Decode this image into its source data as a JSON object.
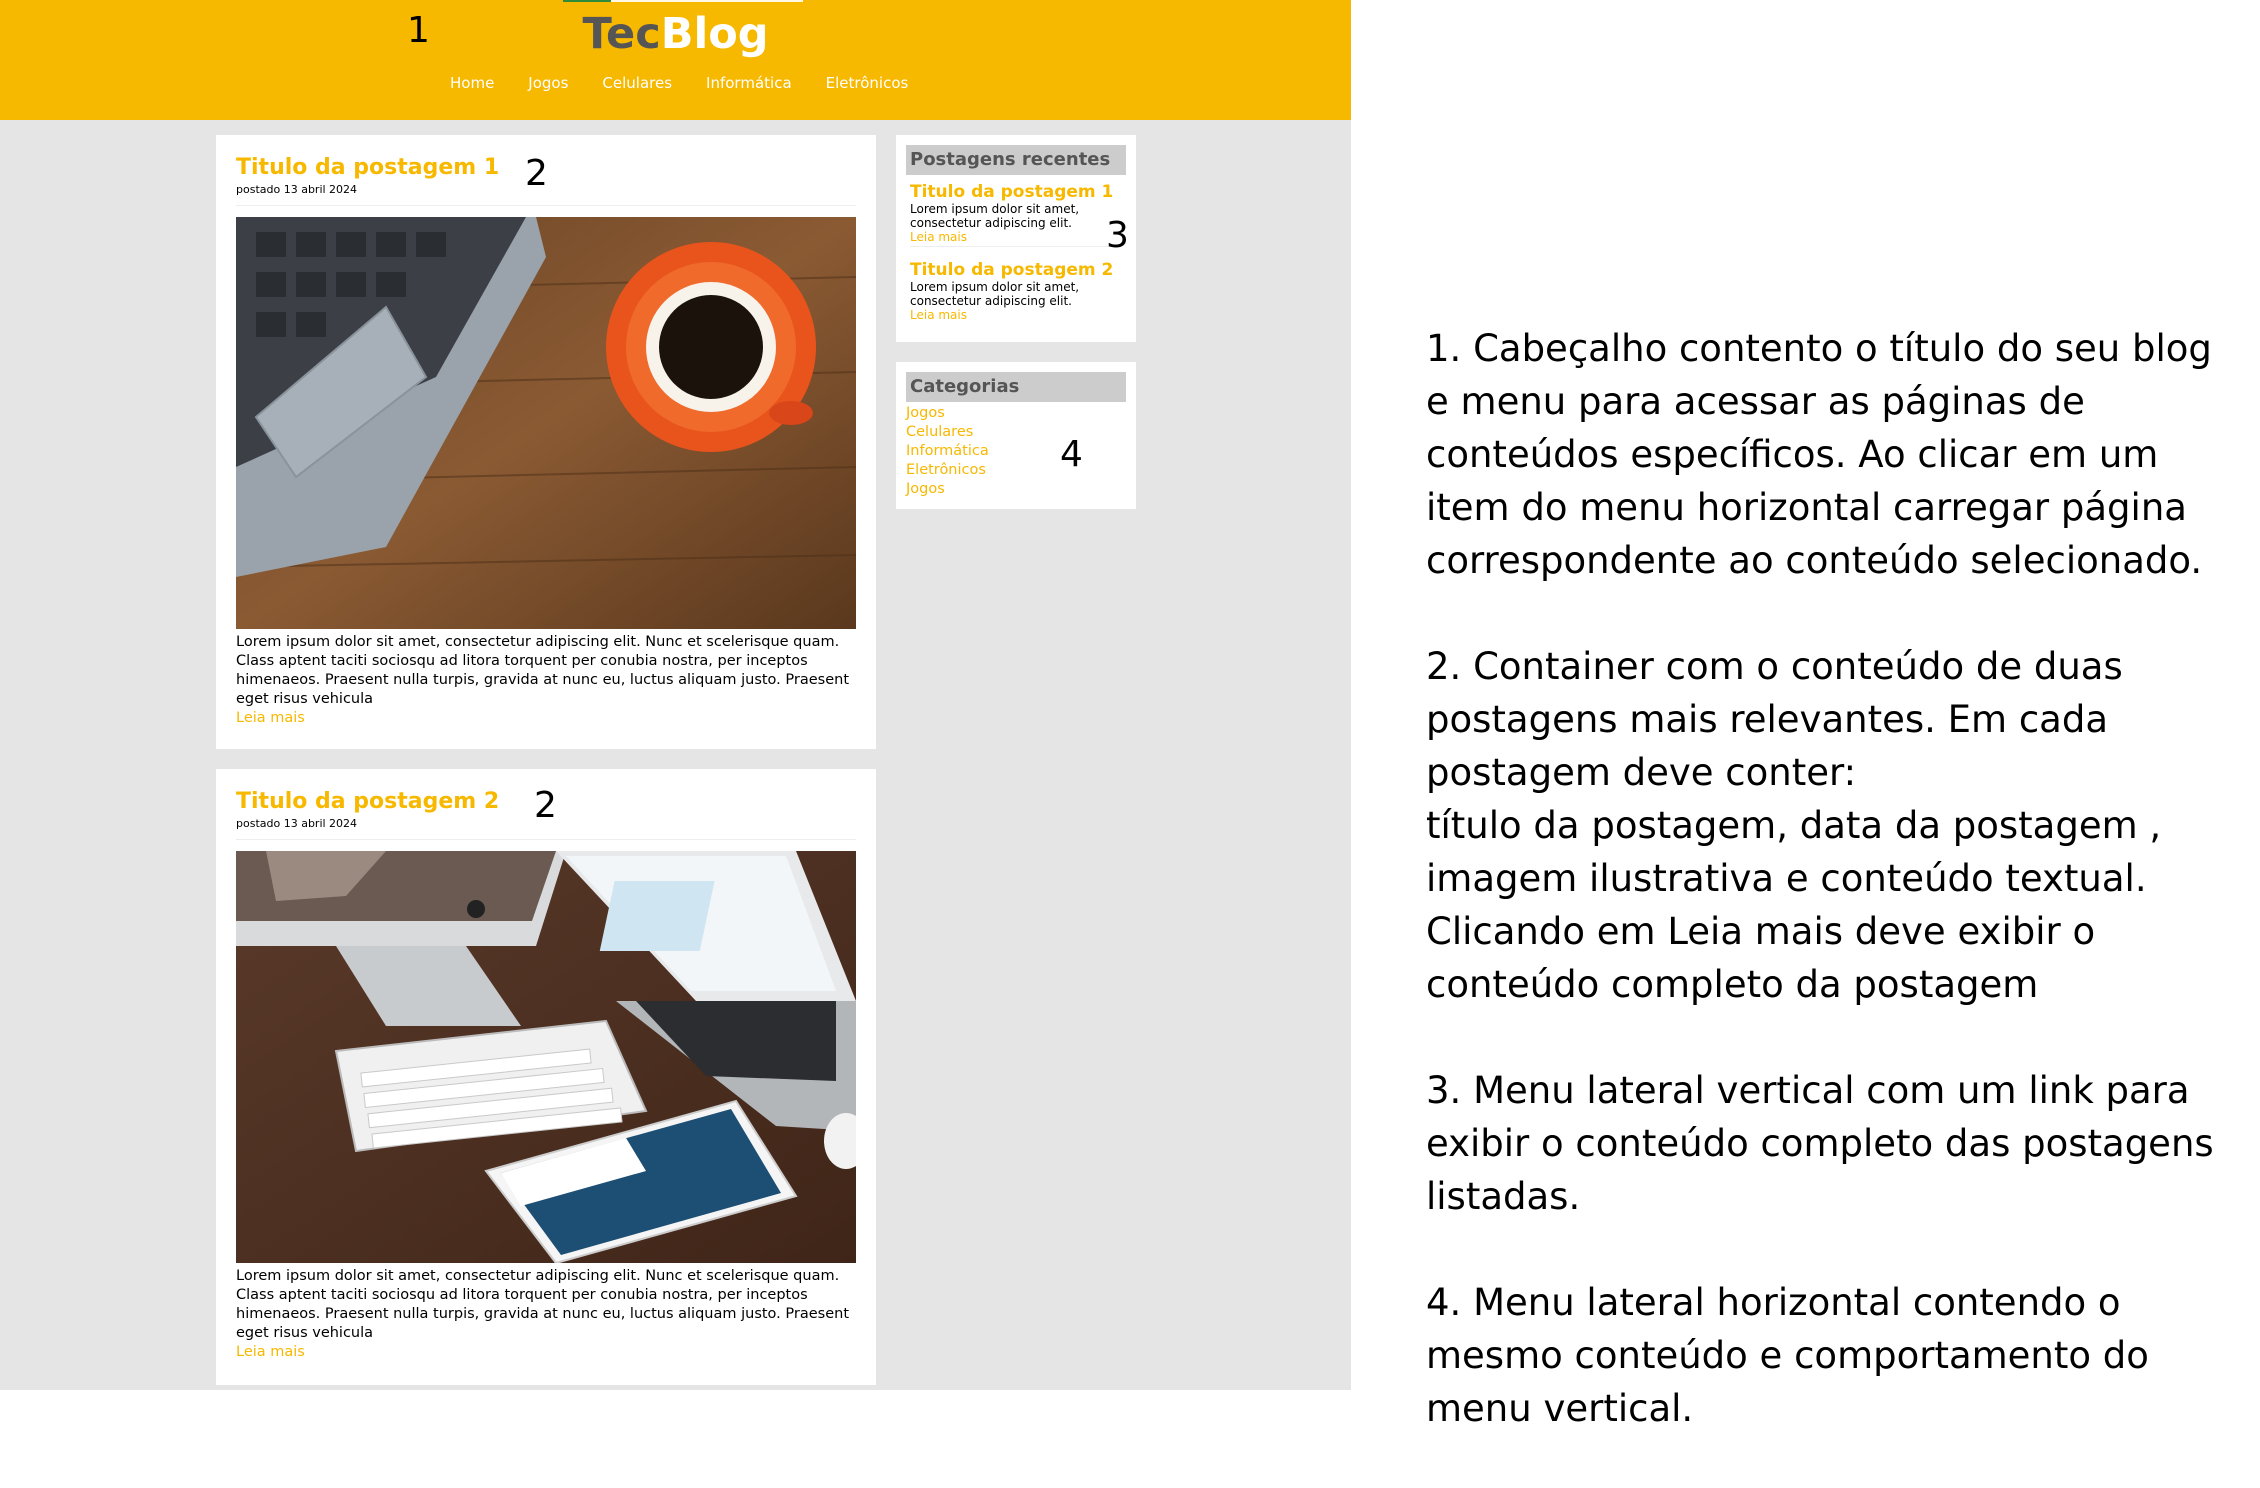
{
  "header": {
    "title_part1": "Tec",
    "title_part2": "Blog",
    "annotation": "1",
    "nav": [
      "Home",
      "Jogos",
      "Celulares",
      "Informática",
      "Eletrônicos"
    ]
  },
  "posts": [
    {
      "title": "Titulo da postagem 1",
      "date": "postado 13 abril 2024",
      "annotation": "2",
      "image": "coffee-cup-laptop-photo",
      "text": "Lorem ipsum dolor sit amet, consectetur adipiscing elit. Nunc et scelerisque quam. Class aptent taciti sociosqu ad litora torquent per conubia nostra, per inceptos himenaeos. Praesent nulla turpis, gravida at nunc eu, luctus aliquam justo. Praesent eget risus vehicula",
      "read_more": "Leia mais"
    },
    {
      "title": "Titulo da postagem 2",
      "date": "postado 13 abril 2024",
      "annotation": "2",
      "image": "imac-macbook-ipad-desk-photo",
      "text": "Lorem ipsum dolor sit amet, consectetur adipiscing elit. Nunc et scelerisque quam. Class aptent taciti sociosqu ad litora torquent per conubia nostra, per inceptos himenaeos. Praesent nulla turpis, gravida at nunc eu, luctus aliquam justo. Praesent eget risus vehicula",
      "read_more": "Leia mais"
    }
  ],
  "recent": {
    "heading": "Postagens recentes",
    "annotation": "3",
    "items": [
      {
        "title": "Titulo da postagem 1",
        "text": "Lorem ipsum dolor sit amet, consectetur adipiscing elit.",
        "more": "Leia mais"
      },
      {
        "title": "Titulo da postagem 2",
        "text": "Lorem ipsum dolor sit amet, consectetur adipiscing elit.",
        "more": "Leia mais"
      }
    ]
  },
  "categories": {
    "heading": "Categorias",
    "annotation": "4",
    "items": [
      "Jogos",
      "Celulares",
      "Informática",
      "Eletrônicos",
      "Jogos"
    ]
  },
  "description": {
    "p1": "1. Cabeçalho contento o título do seu blog e menu para acessar as páginas de conteúdos específicos. Ao clicar em um item do menu horizontal carregar página correspondente ao conteúdo selecionado.",
    "p2a": "2. Container com o conteúdo de duas postagens mais relevantes. Em cada postagem deve conter:",
    "p2b": "título da postagem, data da postagem , imagem ilustrativa e conteúdo textual.",
    "p2c": "Clicando em Leia mais deve exibir o conteúdo completo da postagem",
    "p3": "3. Menu lateral vertical com um link para exibir o conteúdo completo das postagens listadas.",
    "p4": "4. Menu lateral horizontal contendo o mesmo conteúdo e comportamento do menu vertical."
  },
  "colors": {
    "accent": "#f7b800",
    "page_bg": "#e5e5e5",
    "sidebar_heading_bg": "#cccccc"
  }
}
